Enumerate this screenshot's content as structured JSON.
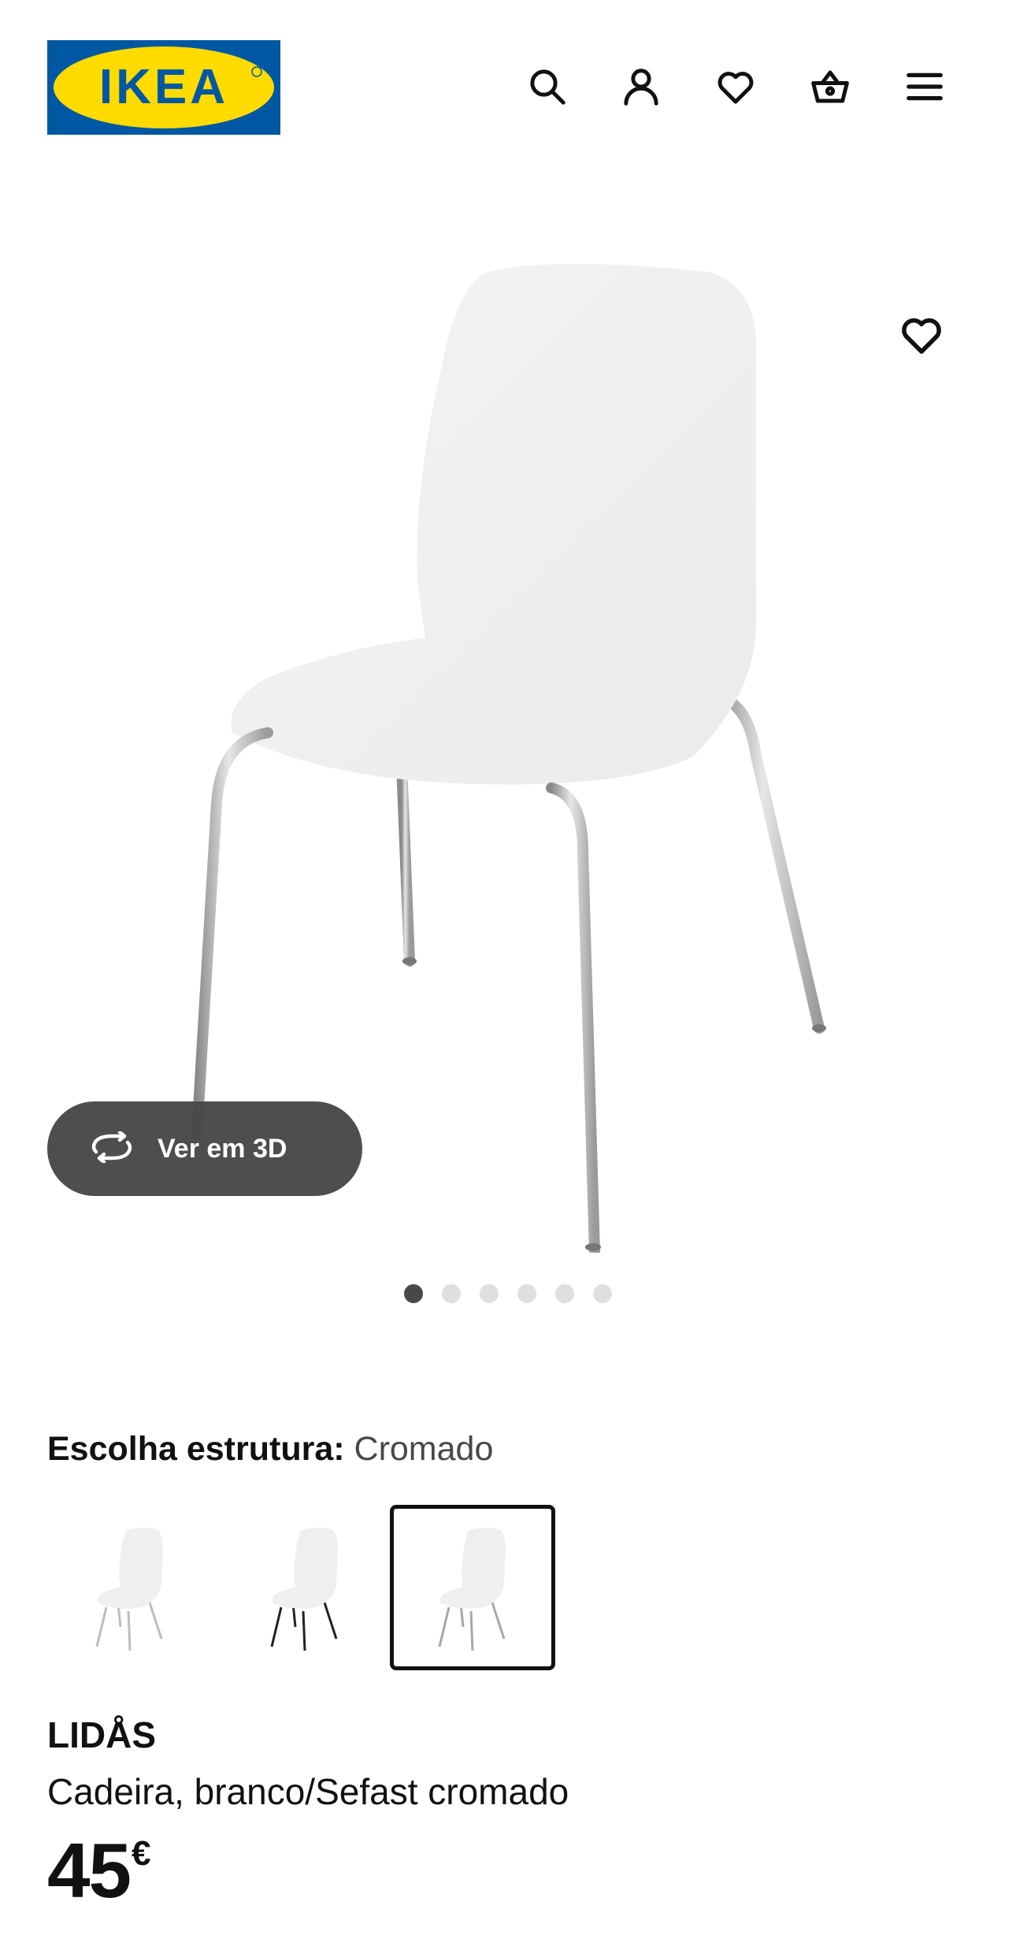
{
  "header": {
    "logo_text": "IKEA",
    "icons": [
      "search-icon",
      "account-icon",
      "heart-icon",
      "basket-icon",
      "menu-icon"
    ]
  },
  "gallery": {
    "view_3d_label": "Ver em 3D",
    "image_count": 6,
    "active_index": 0
  },
  "variant": {
    "label": "Escolha estrutura:",
    "value": "Cromado",
    "options": [
      "white-legs",
      "black-legs",
      "chrome-legs"
    ],
    "selected_index": 2
  },
  "product": {
    "name": "LIDÅS",
    "description": "Cadeira, branco/Sefast cromado",
    "price": "45",
    "currency": "€"
  },
  "colors": {
    "brand_blue": "#0058a3",
    "brand_yellow": "#ffdb00"
  }
}
